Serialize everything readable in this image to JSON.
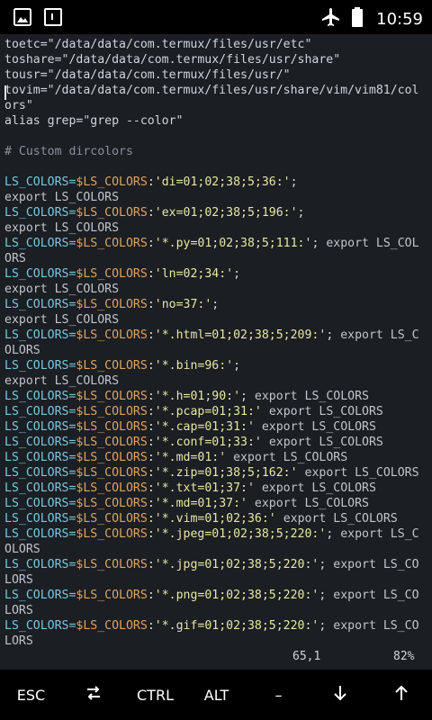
{
  "status_bar": {
    "time": "10:59",
    "left_icons": [
      "gallery-icon",
      "termux-icon"
    ],
    "right_icons": [
      "airplane-icon",
      "battery-icon"
    ]
  },
  "editor": {
    "lines": [
      [
        {
          "t": "normal",
          "v": "toetc=\"/data/data/com.termux/files/usr/etc\""
        }
      ],
      [
        {
          "t": "normal",
          "v": "toshare=\"/data/data/com.termux/files/usr/share\""
        }
      ],
      [
        {
          "t": "normal",
          "v": "tousr=\"/data/data/com.termux/files/usr/\""
        }
      ],
      [
        {
          "t": "normal",
          "v": "tovim=\"/data/data/com.termux/files/usr/share/vim/vim81/col"
        }
      ],
      [
        {
          "t": "normal",
          "v": "ors\""
        }
      ],
      [
        {
          "t": "normal",
          "v": "alias grep=\"grep --color\""
        }
      ],
      [],
      [
        {
          "t": "comment",
          "v": "# Custom dircolors"
        }
      ],
      [],
      [
        {
          "t": "var",
          "v": "LS_COLORS="
        },
        {
          "t": "dollar",
          "v": "$LS_COLORS"
        },
        {
          "t": "sq",
          "v": ":'di=01;02;38;5;36:'"
        },
        {
          "t": "normal",
          "v": ";"
        }
      ],
      [
        {
          "t": "kw",
          "v": "export LS_COLORS"
        }
      ],
      [
        {
          "t": "var",
          "v": "LS_COLORS="
        },
        {
          "t": "dollar",
          "v": "$LS_COLORS"
        },
        {
          "t": "sq",
          "v": ":'ex=01;02;38;5;196:'"
        },
        {
          "t": "normal",
          "v": ";"
        }
      ],
      [
        {
          "t": "kw",
          "v": "export LS_COLORS"
        }
      ],
      [
        {
          "t": "var",
          "v": "LS_COLORS="
        },
        {
          "t": "dollar",
          "v": "$LS_COLORS"
        },
        {
          "t": "sq",
          "v": ":'*.py=01;02;38;5;111:'"
        },
        {
          "t": "normal",
          "v": "; "
        },
        {
          "t": "kw",
          "v": "export LS_COL"
        }
      ],
      [
        {
          "t": "kw",
          "v": "ORS"
        }
      ],
      [
        {
          "t": "var",
          "v": "LS_COLORS="
        },
        {
          "t": "dollar",
          "v": "$LS_COLORS"
        },
        {
          "t": "sq",
          "v": ":'ln=02;34:'"
        },
        {
          "t": "normal",
          "v": ";"
        }
      ],
      [
        {
          "t": "kw",
          "v": "export LS_COLORS"
        }
      ],
      [
        {
          "t": "var",
          "v": "LS_COLORS="
        },
        {
          "t": "dollar",
          "v": "$LS_COLORS"
        },
        {
          "t": "sq",
          "v": ":'no=37:'"
        },
        {
          "t": "normal",
          "v": ";"
        }
      ],
      [
        {
          "t": "kw",
          "v": "export LS_COLORS"
        }
      ],
      [
        {
          "t": "var",
          "v": "LS_COLORS="
        },
        {
          "t": "dollar",
          "v": "$LS_COLORS"
        },
        {
          "t": "sq",
          "v": ":'*.html=01;02;38;5;209:'"
        },
        {
          "t": "normal",
          "v": "; "
        },
        {
          "t": "kw",
          "v": "export LS_C"
        }
      ],
      [
        {
          "t": "kw",
          "v": "OLORS"
        }
      ],
      [
        {
          "t": "var",
          "v": "LS_COLORS="
        },
        {
          "t": "dollar",
          "v": "$LS_COLORS"
        },
        {
          "t": "sq",
          "v": ":'*.bin=96:'"
        },
        {
          "t": "normal",
          "v": ";"
        }
      ],
      [
        {
          "t": "kw",
          "v": "export LS_COLORS"
        }
      ],
      [
        {
          "t": "var",
          "v": "LS_COLORS="
        },
        {
          "t": "dollar",
          "v": "$LS_COLORS"
        },
        {
          "t": "sq",
          "v": ":'*.h=01;90:'"
        },
        {
          "t": "normal",
          "v": "; "
        },
        {
          "t": "kw",
          "v": "export LS_COLORS"
        }
      ],
      [
        {
          "t": "var",
          "v": "LS_COLORS="
        },
        {
          "t": "dollar",
          "v": "$LS_COLORS"
        },
        {
          "t": "sq",
          "v": ":'*.pcap=01;31:'"
        },
        {
          "t": "normal",
          "v": " "
        },
        {
          "t": "kw",
          "v": "export LS_COLORS"
        }
      ],
      [
        {
          "t": "var",
          "v": "LS_COLORS="
        },
        {
          "t": "dollar",
          "v": "$LS_COLORS"
        },
        {
          "t": "sq",
          "v": ":'*.cap=01;31:'"
        },
        {
          "t": "normal",
          "v": " "
        },
        {
          "t": "kw",
          "v": "export LS_COLORS"
        }
      ],
      [
        {
          "t": "var",
          "v": "LS_COLORS="
        },
        {
          "t": "dollar",
          "v": "$LS_COLORS"
        },
        {
          "t": "sq",
          "v": ":'*.conf=01;33:'"
        },
        {
          "t": "normal",
          "v": " "
        },
        {
          "t": "kw",
          "v": "export LS_COLORS"
        }
      ],
      [
        {
          "t": "var",
          "v": "LS_COLORS="
        },
        {
          "t": "dollar",
          "v": "$LS_COLORS"
        },
        {
          "t": "sq",
          "v": ":'*.md=01:'"
        },
        {
          "t": "normal",
          "v": " "
        },
        {
          "t": "kw",
          "v": "export LS_COLORS"
        }
      ],
      [
        {
          "t": "var",
          "v": "LS_COLORS="
        },
        {
          "t": "dollar",
          "v": "$LS_COLORS"
        },
        {
          "t": "sq",
          "v": ":'*.zip=01;38;5;162:'"
        },
        {
          "t": "normal",
          "v": " "
        },
        {
          "t": "kw",
          "v": "export LS_COLORS"
        }
      ],
      [
        {
          "t": "var",
          "v": "LS_COLORS="
        },
        {
          "t": "dollar",
          "v": "$LS_COLORS"
        },
        {
          "t": "sq",
          "v": ":'*.txt=01;37:'"
        },
        {
          "t": "normal",
          "v": " "
        },
        {
          "t": "kw",
          "v": "export LS_COLORS"
        }
      ],
      [
        {
          "t": "var",
          "v": "LS_COLORS="
        },
        {
          "t": "dollar",
          "v": "$LS_COLORS"
        },
        {
          "t": "sq",
          "v": ":'*.md=01;37:'"
        },
        {
          "t": "normal",
          "v": " "
        },
        {
          "t": "kw",
          "v": "export LS_COLORS"
        }
      ],
      [
        {
          "t": "var",
          "v": "LS_COLORS="
        },
        {
          "t": "dollar",
          "v": "$LS_COLORS"
        },
        {
          "t": "sq",
          "v": ":'*.vim=01;02;36:'"
        },
        {
          "t": "normal",
          "v": " "
        },
        {
          "t": "kw",
          "v": "export LS_COLORS"
        }
      ],
      [
        {
          "t": "var",
          "v": "LS_COLORS="
        },
        {
          "t": "dollar",
          "v": "$LS_COLORS"
        },
        {
          "t": "sq",
          "v": ":'*.jpeg=01;02;38;5;220:'"
        },
        {
          "t": "normal",
          "v": "; "
        },
        {
          "t": "kw",
          "v": "export LS_C"
        }
      ],
      [
        {
          "t": "kw",
          "v": "OLORS"
        }
      ],
      [
        {
          "t": "var",
          "v": "LS_COLORS="
        },
        {
          "t": "dollar",
          "v": "$LS_COLORS"
        },
        {
          "t": "sq",
          "v": ":'*.jpg=01;02;38;5;220:'"
        },
        {
          "t": "normal",
          "v": "; "
        },
        {
          "t": "kw",
          "v": "export LS_CO"
        }
      ],
      [
        {
          "t": "kw",
          "v": "LORS"
        }
      ],
      [
        {
          "t": "var",
          "v": "LS_COLORS="
        },
        {
          "t": "dollar",
          "v": "$LS_COLORS"
        },
        {
          "t": "sq",
          "v": ":'*.png=01;02;38;5;220:'"
        },
        {
          "t": "normal",
          "v": "; "
        },
        {
          "t": "kw",
          "v": "export LS_CO"
        }
      ],
      [
        {
          "t": "kw",
          "v": "LORS"
        }
      ],
      [
        {
          "t": "var",
          "v": "LS_COLORS="
        },
        {
          "t": "dollar",
          "v": "$LS_COLORS"
        },
        {
          "t": "sq",
          "v": ":'*.gif=01;02;38;5;220:'"
        },
        {
          "t": "normal",
          "v": "; "
        },
        {
          "t": "kw",
          "v": "export LS_CO"
        }
      ],
      [
        {
          "t": "kw",
          "v": "LORS"
        }
      ]
    ],
    "status_position": "65,1",
    "status_percent": "82%"
  },
  "extra_keys": [
    {
      "label": "ESC",
      "icon": null,
      "name": "esc-key"
    },
    {
      "label": "",
      "icon": "swap-icon",
      "name": "tab-key"
    },
    {
      "label": "CTRL",
      "icon": null,
      "name": "ctrl-key"
    },
    {
      "label": "ALT",
      "icon": null,
      "name": "alt-key"
    },
    {
      "label": "–",
      "icon": null,
      "name": "dash-key"
    },
    {
      "label": "",
      "icon": "arrow-down-icon",
      "name": "down-key"
    },
    {
      "label": "",
      "icon": "arrow-up-icon",
      "name": "up-key"
    }
  ]
}
